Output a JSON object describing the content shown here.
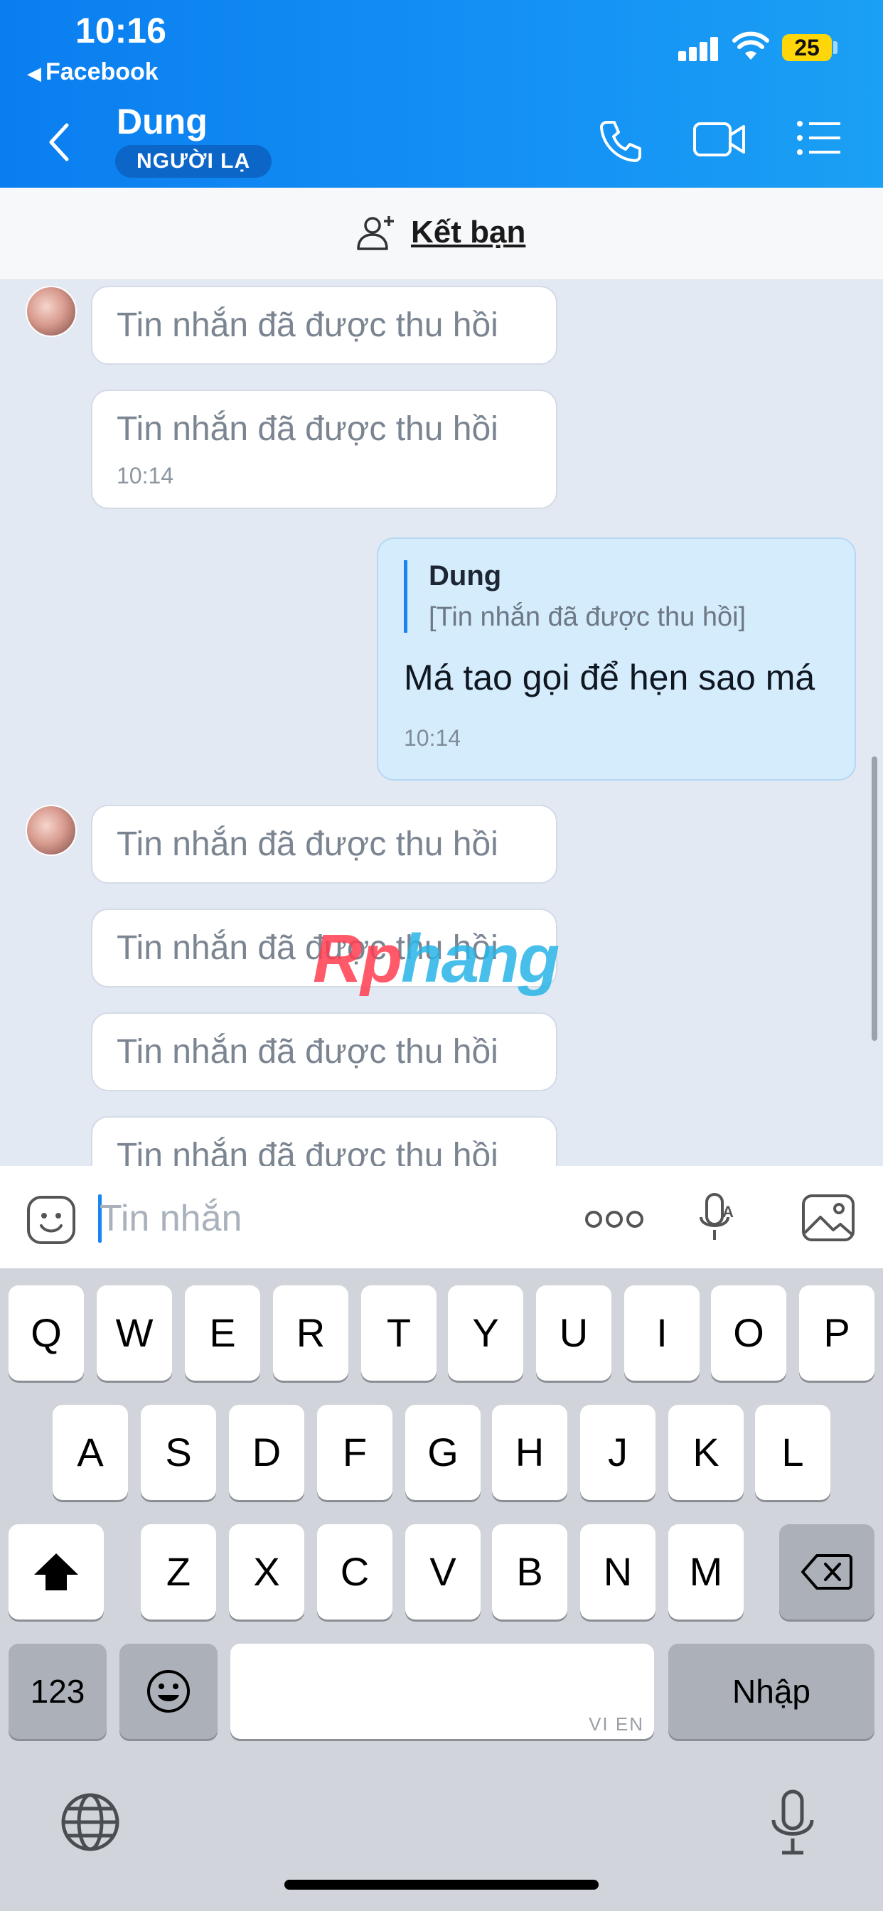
{
  "status_bar": {
    "time": "10:16",
    "back_app": "Facebook",
    "battery": "25"
  },
  "header": {
    "name": "Dung",
    "badge": "NGƯỜI LẠ",
    "icons": [
      "phone-icon",
      "video-call-icon",
      "list-menu-icon"
    ]
  },
  "add_friend": {
    "label": "Kết bạn"
  },
  "messages": [
    {
      "text": "Tin nhắn đã được thu hồi"
    },
    {
      "text": "Tin nhắn đã được thu hồi",
      "time": "10:14"
    },
    {
      "quote_name": "Dung",
      "quote_text": "[Tin nhắn đã được thu hồi]",
      "text": "Má tao gọi để hẹn sao má",
      "time": "10:14"
    },
    {
      "text": "Tin nhắn đã được thu hồi"
    },
    {
      "text": "Tin nhắn đã được thu hồi"
    },
    {
      "text": "Tin nhắn đã được thu hồi"
    },
    {
      "text": "Tin nhắn đã được thu hồi"
    }
  ],
  "watermark": {
    "part1": "Rp",
    "part2": "hang"
  },
  "input": {
    "placeholder": "Tin nhắn",
    "more": "ooo"
  },
  "keyboard": {
    "row1": [
      "Q",
      "W",
      "E",
      "R",
      "T",
      "Y",
      "U",
      "I",
      "O",
      "P"
    ],
    "row2": [
      "A",
      "S",
      "D",
      "F",
      "G",
      "H",
      "J",
      "K",
      "L"
    ],
    "row3": [
      "Z",
      "X",
      "C",
      "V",
      "B",
      "N",
      "M"
    ],
    "numbers": "123",
    "space_hint": "VI EN",
    "enter": "Nhập"
  },
  "colors": {
    "header_blue": "#0a7ef0",
    "badge": "#0b66c8",
    "sent_bubble": "#d5ecfd"
  }
}
